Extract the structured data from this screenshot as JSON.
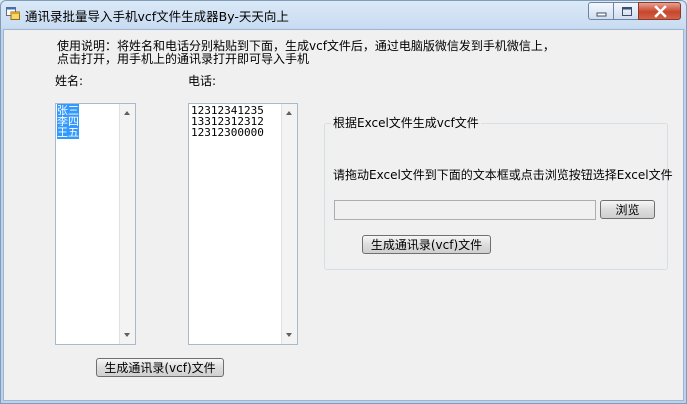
{
  "window": {
    "title": "通讯录批量导入手机vcf文件生成器By-天天向上"
  },
  "instructions": {
    "line1": "使用说明：将姓名和电话分别粘贴到下面，生成vcf文件后，通过电脑版微信发到手机微信上，",
    "line2": "点击打开，用手机上的通讯录打开即可导入手机"
  },
  "names": {
    "label": "姓名:",
    "items": [
      "张三",
      "李四",
      "王五"
    ]
  },
  "phones": {
    "label": "电话:",
    "items": [
      "12312341235",
      "13312312312",
      "12312300000"
    ]
  },
  "generate_button": "生成通讯录(vcf)文件",
  "excel_group": {
    "title": "根据Excel文件生成vcf文件",
    "hint": "请拖动Excel文件到下面的文本框或点击浏览按钮选择Excel文件",
    "file_path": "",
    "browse_label": "浏览",
    "generate_label": "生成通讯录(vcf)文件"
  },
  "colors": {
    "selection": "#3399ff",
    "close_button": "#c7452c"
  }
}
